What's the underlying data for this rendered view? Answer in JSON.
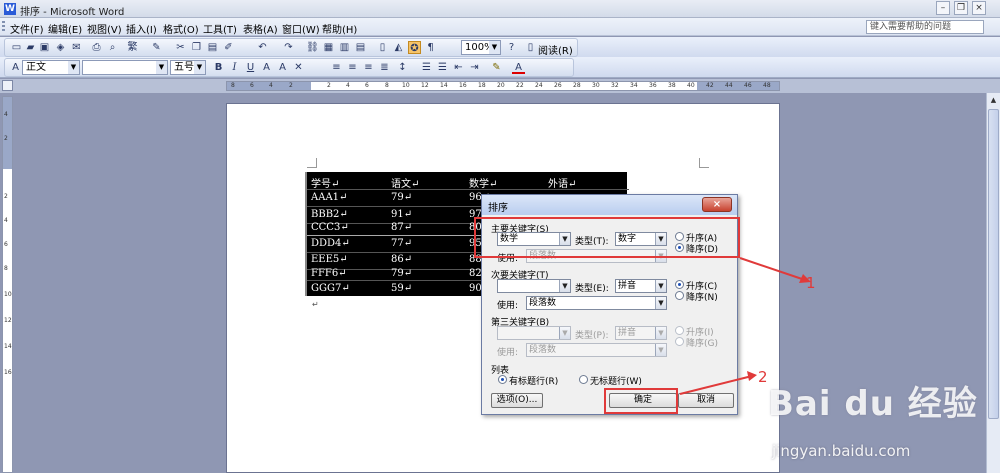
{
  "window": {
    "title": "排序 - Microsoft Word",
    "app_icon": "W"
  },
  "menu": [
    "文件(F)",
    "编辑(E)",
    "视图(V)",
    "插入(I)",
    "格式(O)",
    "工具(T)",
    "表格(A)",
    "窗口(W)",
    "帮助(H)"
  ],
  "help_search_placeholder": "键入需要帮助的问题",
  "toolbar": {
    "zoom": "100%",
    "read_label": "阅读(R)",
    "style": "正文",
    "font_size": "五号"
  },
  "ruler": {
    "h_numbers": [
      "8",
      "6",
      "4",
      "2",
      "2",
      "4",
      "6",
      "8",
      "10",
      "12",
      "14",
      "16",
      "18",
      "20",
      "22",
      "24",
      "26",
      "28",
      "30",
      "32",
      "34",
      "36",
      "38",
      "40",
      "42",
      "44",
      "46",
      "48"
    ],
    "v_numbers": [
      "4",
      "2",
      "2",
      "4",
      "6",
      "8",
      "10",
      "12",
      "14",
      "16"
    ]
  },
  "document_table": {
    "headers": [
      "学号↵",
      "语文↵",
      "数学↵",
      "外语↵"
    ],
    "rows": [
      [
        "AAA1↵",
        "79↵",
        "96↵"
      ],
      [
        "BBB2↵",
        "91↵",
        "97↵"
      ],
      [
        "CCC3↵",
        "87↵",
        "80↵"
      ],
      [
        "DDD4↵",
        "77↵",
        "95↵"
      ],
      [
        "EEE5↵",
        "86↵",
        "88↵"
      ],
      [
        "FFF6↵",
        "79↵",
        "82↵"
      ],
      [
        "GGG7↵",
        "59↵",
        "90↵"
      ]
    ],
    "trailing_mark": "↵"
  },
  "sort_dialog": {
    "title": "排序",
    "close": "×",
    "primary": {
      "label": "主要关键字(S)",
      "key": "数学",
      "type_label": "类型(T):",
      "type": "数字",
      "use_label": "使用:",
      "use": "段落数",
      "asc": "升序(A)",
      "desc": "降序(D)",
      "order": "desc"
    },
    "secondary": {
      "label": "次要关键字(T)",
      "key": "",
      "type_label": "类型(E):",
      "type": "拼音",
      "use_label": "使用:",
      "use": "段落数",
      "asc": "升序(C)",
      "desc": "降序(N)",
      "order": "asc"
    },
    "tertiary": {
      "label": "第三关键字(B)",
      "key": "",
      "type_label": "类型(P):",
      "type": "拼音",
      "use_label": "使用:",
      "use": "段落数",
      "asc": "升序(I)",
      "desc": "降序(G)",
      "order": "asc",
      "disabled": true
    },
    "list": {
      "label": "列表",
      "header_row": "有标题行(R)",
      "no_header_row": "无标题行(W)",
      "selected": "header_row"
    },
    "buttons": {
      "options": "选项(O)...",
      "ok": "确定",
      "cancel": "取消"
    }
  },
  "annotations": {
    "colors": {
      "highlight": "#e03a3a"
    },
    "labels": [
      "1",
      "2"
    ]
  },
  "watermark": {
    "logo": "Bai du 经验",
    "url": "jingyan.baidu.com"
  }
}
